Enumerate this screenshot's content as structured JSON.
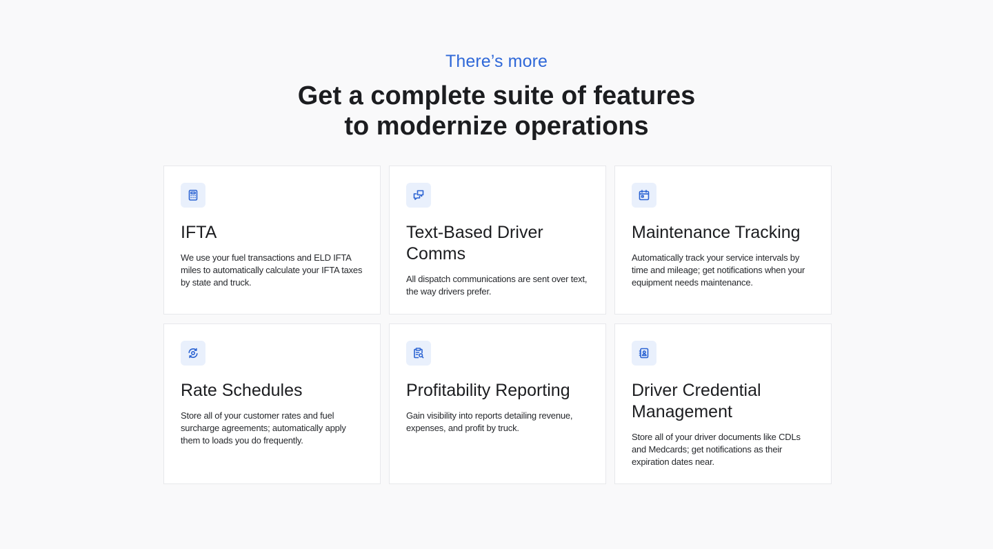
{
  "section": {
    "eyebrow": "There’s more",
    "headline_line1": "Get a complete suite of features",
    "headline_line2": "to modernize operations"
  },
  "colors": {
    "accent": "#2f68d8",
    "icon_bg": "#e9f0fc",
    "card_border": "#e7e8eb",
    "page_bg": "#f9f9fa"
  },
  "features": [
    {
      "icon": "calculator-icon",
      "title": "IFTA",
      "description": "We use your fuel transactions and ELD IFTA miles to automatically calculate your IFTA taxes by state and truck."
    },
    {
      "icon": "chat-bubbles-icon",
      "title": "Text-Based Driver Comms",
      "description": "All dispatch communications are sent over text, the way drivers prefer."
    },
    {
      "icon": "calendar-icon",
      "title": "Maintenance Tracking",
      "description": "Automatically track your service intervals by time and mileage; get notifications when your equipment needs maintenance."
    },
    {
      "icon": "refresh-target-icon",
      "title": "Rate Schedules",
      "description": "Store all of your customer rates and fuel surcharge agreements; automatically apply them to loads you do frequently."
    },
    {
      "icon": "clipboard-search-icon",
      "title": "Profitability Reporting",
      "description": "Gain visibility into reports detailing revenue, expenses, and profit by truck."
    },
    {
      "icon": "id-card-icon",
      "title": "Driver Credential Management",
      "description": "Store all of your driver documents like CDLs and Medcards; get notifications as their expiration dates near."
    }
  ]
}
